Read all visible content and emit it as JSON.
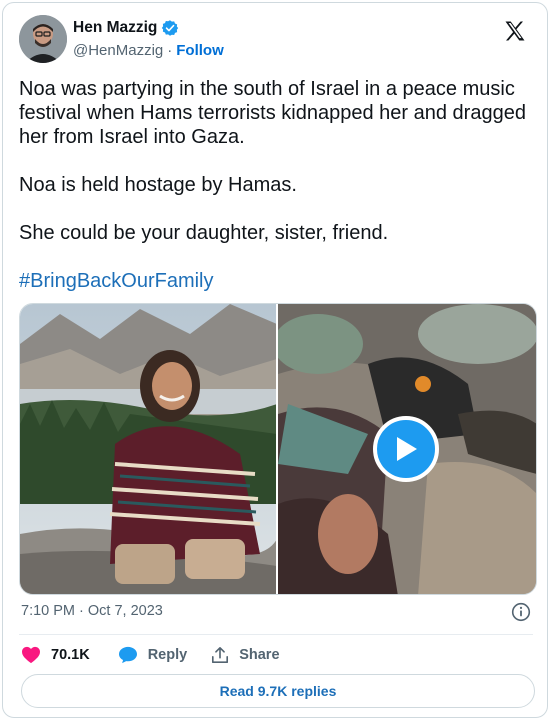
{
  "author": {
    "display_name": "Hen Mazzig",
    "handle": "@HenMazzig",
    "separator": "·",
    "follow_label": "Follow",
    "avatar_icon": "person-avatar",
    "verified_icon": "verified-badge-icon"
  },
  "tweet": {
    "paragraphs": [
      "Noa was partying in the south of Israel in a peace music festival when Hams terrorists kidnapped her and dragged her from Israel into Gaza.",
      "Noa is held hostage by Hamas.",
      "She could be your daughter, sister, friend."
    ],
    "hashtag": "#BringBackOurFamily"
  },
  "media": {
    "left_image": "photo-woman-sitting-mountains",
    "right_image": "video-thumbnail",
    "play_icon": "play-icon"
  },
  "meta": {
    "timestamp": "7:10 PM · Oct 7, 2023"
  },
  "actions": {
    "likes_count": "70.1K",
    "reply_label": "Reply",
    "share_label": "Share"
  },
  "footer": {
    "read_replies_label": "Read 9.7K replies"
  },
  "colors": {
    "brand_blue": "#1d9bf0",
    "link_blue": "#1d6fb8",
    "like_red": "#f91880",
    "muted": "#536471"
  }
}
